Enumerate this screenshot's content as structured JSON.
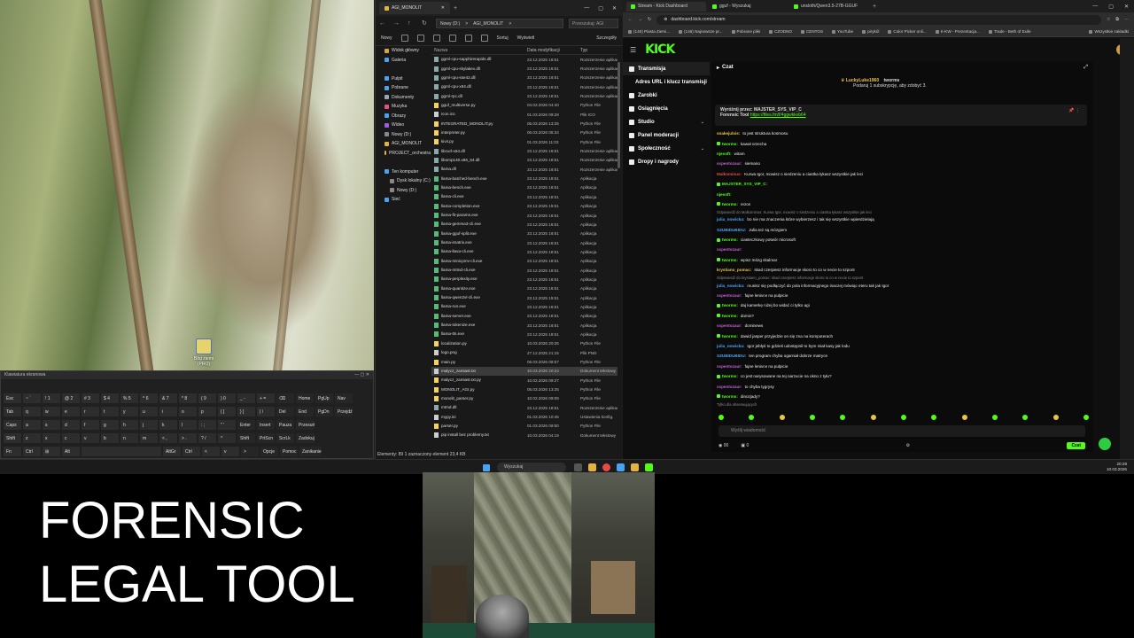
{
  "desktop": {
    "icon_label": "Bóg ziemi (PRO)"
  },
  "keyboard": {
    "title": "Klawiatura ekranowa",
    "rows": [
      [
        "Esc",
        "~ `",
        "! 1",
        "@ 2",
        "# 3",
        "$ 4",
        "% 5",
        "^ 6",
        "& 7",
        "* 8",
        "( 9",
        ") 0",
        "_ -",
        "+ =",
        "⌫",
        "Home",
        "PgUp",
        "Nav"
      ],
      [
        "Tab",
        "q",
        "w",
        "e",
        "r",
        "t",
        "y",
        "u",
        "i",
        "o",
        "p",
        "{ [",
        "} ]",
        "| \\",
        "Del",
        "End",
        "PgDn",
        "Przejdź"
      ],
      [
        "Caps",
        "a",
        "s",
        "d",
        "f",
        "g",
        "h",
        "j",
        "k",
        "l",
        ": ;",
        "\" '",
        "Enter",
        "Insert",
        "Pauza",
        "Przesuń"
      ],
      [
        "Shift",
        "z",
        "x",
        "c",
        "v",
        "b",
        "n",
        "m",
        "< ,",
        "> .",
        "? /",
        "^",
        "Shift",
        "PrtScn",
        "ScrLk",
        "Zadokuj"
      ],
      [
        "Fn",
        "Ctrl",
        "⊞",
        "Alt",
        "",
        "AltGr",
        "Ctrl",
        "<",
        "v",
        ">",
        "Opcje",
        "Pomoc",
        "Zanikanie"
      ]
    ]
  },
  "explorer": {
    "tab_title": "AGI_MONOLIT",
    "address": [
      "Nowy (D:)",
      ">",
      "AGI_MONOLIT",
      ">"
    ],
    "search_placeholder": "Przeszukaj: AGI",
    "toolbar": {
      "new": "Nowy",
      "sort": "Sortuj",
      "view": "Wyświetl",
      "details": "Szczegóły"
    },
    "nav_items": [
      {
        "label": "Widok główny",
        "color": "#d9a441"
      },
      {
        "label": "Galeria",
        "color": "#4aa3f0"
      },
      {
        "label": "",
        "color": "#000000"
      },
      {
        "label": "Pulpit",
        "color": "#4aa3f0"
      },
      {
        "label": "Pobrane",
        "color": "#4aa3f0"
      },
      {
        "label": "Dokumenty",
        "color": "#9aa7b8"
      },
      {
        "label": "Muzyka",
        "color": "#e8507a"
      },
      {
        "label": "Obrazy",
        "color": "#4aa3f0"
      },
      {
        "label": "Wideo",
        "color": "#9c5ee0"
      },
      {
        "label": "Nowy (D:)",
        "color": "#888888"
      },
      {
        "label": "AGI_MONOLIT",
        "color": "#e3b341"
      },
      {
        "label": "PROJECT_orchestra",
        "color": "#e3b341"
      },
      {
        "label": "",
        "color": "#000000"
      },
      {
        "label": "Ten komputer",
        "color": "#4aa3f0"
      },
      {
        "label": "Dysk lokalny (C:)",
        "color": "#888888"
      },
      {
        "label": "Nowy (D:)",
        "color": "#888888"
      },
      {
        "label": "Sieć",
        "color": "#4aa3f0"
      }
    ],
    "columns": [
      "Nazwa",
      "Data modyfikacji",
      "Typ"
    ],
    "files": [
      {
        "name": "ggml-cpu-sapphirerapids.dll",
        "date": "23.12.2025 18:51",
        "type": "Rozszerzenie aplikacji",
        "kind": "dll"
      },
      {
        "name": "ggml-cpu-skylakex.dll",
        "date": "23.12.2025 18:51",
        "type": "Rozszerzenie aplikacji",
        "kind": "dll"
      },
      {
        "name": "ggml-cpu-sse42.dll",
        "date": "23.12.2025 18:51",
        "type": "Rozszerzenie aplikacji",
        "kind": "dll"
      },
      {
        "name": "ggml-cpu-x64.dll",
        "date": "23.12.2025 18:51",
        "type": "Rozszerzenie aplikacji",
        "kind": "dll"
      },
      {
        "name": "ggml-rpc.dll",
        "date": "23.12.2025 18:51",
        "type": "Rozszerzenie aplikacji",
        "kind": "dll"
      },
      {
        "name": "gguf_multiverse.py",
        "date": "04.02.2026 04:40",
        "type": "Python File",
        "kind": "py"
      },
      {
        "name": "icon.ico",
        "date": "01.03.2026 09:28",
        "type": "Plik ICO",
        "kind": "txt"
      },
      {
        "name": "INTEGRATED_MONOLIT.py",
        "date": "05.03.2026 13:25",
        "type": "Python File",
        "kind": "py"
      },
      {
        "name": "interpreter.py",
        "date": "06.03.2026 05:34",
        "type": "Python File",
        "kind": "py"
      },
      {
        "name": "kivir.py",
        "date": "01.03.2026 11:03",
        "type": "Python File",
        "kind": "py"
      },
      {
        "name": "libcurl-x64.dll",
        "date": "23.12.2025 18:51",
        "type": "Rozszerzenie aplikacji",
        "kind": "dll"
      },
      {
        "name": "libomp140.x86_64.dll",
        "date": "23.12.2025 18:51",
        "type": "Rozszerzenie aplikacji",
        "kind": "dll"
      },
      {
        "name": "llama.dll",
        "date": "23.12.2025 18:51",
        "type": "Rozszerzenie aplikacji",
        "kind": "dll"
      },
      {
        "name": "llama-batched-bench.exe",
        "date": "23.12.2025 18:51",
        "type": "Aplikacja",
        "kind": "exe"
      },
      {
        "name": "llama-bench.exe",
        "date": "23.12.2025 18:51",
        "type": "Aplikacja",
        "kind": "exe"
      },
      {
        "name": "llama-cli.exe",
        "date": "23.12.2025 18:51",
        "type": "Aplikacja",
        "kind": "exe"
      },
      {
        "name": "llama-completion.exe",
        "date": "23.12.2025 18:51",
        "type": "Aplikacja",
        "kind": "exe"
      },
      {
        "name": "llama-fit-params.exe",
        "date": "23.12.2025 18:51",
        "type": "Aplikacja",
        "kind": "exe"
      },
      {
        "name": "llama-gemma3-cli.exe",
        "date": "23.12.2025 18:51",
        "type": "Aplikacja",
        "kind": "exe"
      },
      {
        "name": "llama-gguf-split.exe",
        "date": "23.12.2025 18:51",
        "type": "Aplikacja",
        "kind": "exe"
      },
      {
        "name": "llama-imatrix.exe",
        "date": "23.12.2025 18:51",
        "type": "Aplikacja",
        "kind": "exe"
      },
      {
        "name": "llama-llava-cli.exe",
        "date": "23.12.2025 18:51",
        "type": "Aplikacja",
        "kind": "exe"
      },
      {
        "name": "llama-minicpmv-cli.exe",
        "date": "23.12.2025 18:51",
        "type": "Aplikacja",
        "kind": "exe"
      },
      {
        "name": "llama-mtmd-cli.exe",
        "date": "23.12.2025 18:51",
        "type": "Aplikacja",
        "kind": "exe"
      },
      {
        "name": "llama-perplexity.exe",
        "date": "23.12.2025 18:51",
        "type": "Aplikacja",
        "kind": "exe"
      },
      {
        "name": "llama-quantize.exe",
        "date": "23.12.2025 18:51",
        "type": "Aplikacja",
        "kind": "exe"
      },
      {
        "name": "llama-qwen2vl-cli.exe",
        "date": "23.12.2025 18:51",
        "type": "Aplikacja",
        "kind": "exe"
      },
      {
        "name": "llama-run.exe",
        "date": "23.12.2025 18:51",
        "type": "Aplikacja",
        "kind": "exe"
      },
      {
        "name": "llama-server.exe",
        "date": "23.12.2025 18:51",
        "type": "Aplikacja",
        "kind": "exe"
      },
      {
        "name": "llama-tokenize.exe",
        "date": "23.12.2025 18:51",
        "type": "Aplikacja",
        "kind": "exe"
      },
      {
        "name": "llama-tts.exe",
        "date": "23.12.2025 18:51",
        "type": "Aplikacja",
        "kind": "exe"
      },
      {
        "name": "localization.py",
        "date": "10.03.2026 20:25",
        "type": "Python File",
        "kind": "py"
      },
      {
        "name": "logo.png",
        "date": "27.12.2025 21:15",
        "type": "Plik PNG",
        "kind": "txt"
      },
      {
        "name": "main.py",
        "date": "06.03.2026 08:57",
        "type": "Python File",
        "kind": "py"
      },
      {
        "name": "malycz_zamiast.txt",
        "date": "10.03.2026 20:24",
        "type": "Dokument tekstowy",
        "kind": "txt",
        "selected": true
      },
      {
        "name": "malycz_zamiast.txt.py",
        "date": "10.02.2026 09:27",
        "type": "Python File",
        "kind": "py"
      },
      {
        "name": "MONOLIT_AGI.py",
        "date": "05.03.2026 13:25",
        "type": "Python File",
        "kind": "py"
      },
      {
        "name": "monolit_parser.py",
        "date": "10.02.2026 09:09",
        "type": "Python File",
        "kind": "py"
      },
      {
        "name": "mtmd.dll",
        "date": "23.12.2025 18:51",
        "type": "Rozszerzenie aplikacji",
        "kind": "dll"
      },
      {
        "name": "mypy.ini",
        "date": "01.03.2026 10:45",
        "type": "Ustawienia konfig.",
        "kind": "txt"
      },
      {
        "name": "parser.py",
        "date": "01.03.2026 09:50",
        "type": "Python File",
        "kind": "py"
      },
      {
        "name": "pip install bez problemy.txt",
        "date": "10.03.2026 04:19",
        "type": "Dokument tekstowy",
        "kind": "txt"
      }
    ],
    "status": "Elementy: 89   1 zaznaczony element  23,4 KB"
  },
  "browser": {
    "tabs": [
      {
        "label": "Stream - Kick Dashboard",
        "active": true
      },
      {
        "label": "gguf - Wyszukaj",
        "active": false
      },
      {
        "label": "unsloth/Qwen3.5-27B-GGUF",
        "active": false
      }
    ],
    "url": "dashboard.kick.com/stream",
    "bookmarks": [
      "(146) Piasta Ziemi...",
      "(146) Najnowsze pr...",
      "Pobrane pliki",
      "CZODNO",
      "CENTOS",
      "YouTube",
      "pirykól",
      "Color Picker onli...",
      "K-KW - Prezentacja...",
      "Trade - Beth of Exile",
      "Wszystkie zakładki"
    ],
    "kick": {
      "logo": "KICK",
      "sidebar": [
        {
          "label": "Transmisja",
          "selected": true,
          "chevron": false
        },
        {
          "label": "Adres URL i klucz transmisji",
          "selected": false,
          "chevron": false
        },
        {
          "label": "Zarobki",
          "selected": false,
          "chevron": false
        },
        {
          "label": "Osiągnięcia",
          "selected": false,
          "chevron": false
        },
        {
          "label": "Studio",
          "selected": false,
          "chevron": true
        },
        {
          "label": "Panel moderacji",
          "selected": false,
          "chevron": false
        },
        {
          "label": "Społeczność",
          "selected": false,
          "chevron": true
        },
        {
          "label": "Dropy i nagrody",
          "selected": false,
          "chevron": false
        }
      ],
      "chat_title": "Czat",
      "pinned_user": "LuckyLuke1960",
      "pinned_user_target": "tworms",
      "pinned_user_sub": "Podaruj 1 subskrypcję, aby zdobyć 3.",
      "pinned_by": "Wyróżnij przez: MAJSTER_SYS_VIP_C",
      "pinned_text": "Forensic Tool",
      "pinned_link": "https://files.fm/f/4ggwkkvb64",
      "messages": [
        {
          "user": "snakejulsis:",
          "text": "to jest struktura kosmosu",
          "color": "#e8c547",
          "badge": false,
          "reply": false
        },
        {
          "user": "tworms:",
          "text": "kawał orzecha",
          "color": "#53fc18",
          "badge": true,
          "reply": false
        },
        {
          "user": "njesoft:",
          "text": "witam",
          "color": "#53fc18",
          "badge": false,
          "reply": false
        },
        {
          "user": "sspentozaur:",
          "text": "siemano",
          "color": "#c65bd8",
          "badge": false,
          "reply": false
        },
        {
          "user": "Malkominus:",
          "text": "Kurwa Igor, mowisz o siedzeniu a ciastka łykasz wszystkie jak leci",
          "color": "#e84a4a",
          "badge": false,
          "reply": false
        },
        {
          "user": "MAJSTER_SYS_VIP_C:",
          "text": "",
          "color": "#53fc18",
          "badge": true,
          "reply": false
        },
        {
          "user": "njesoft:",
          "text": "",
          "color": "#53fc18",
          "badge": false,
          "reply": false
        },
        {
          "user": "tworms:",
          "text": "rezon",
          "color": "#53fc18",
          "badge": true,
          "reply": false
        },
        {
          "user": "",
          "text": "Odpowiedź do Malkominus: Kurwa Igor, mowisz o siedzeniu a ciastka łykasz wszystkie jak leci",
          "color": "#888888",
          "badge": false,
          "reply": true
        },
        {
          "user": "julia_nowicka:",
          "text": "bo nie ma znaczenia które wybierzesz i tak się wszystkie wpierdzielają",
          "color": "#4aa3f0",
          "badge": false,
          "reply": false
        },
        {
          "user": "SZUBIDUBIDU:",
          "text": "Julia też są mózgiem",
          "color": "#4aa3f0",
          "badge": false,
          "reply": false
        },
        {
          "user": "tworms:",
          "text": "ciasteczkowy potwór microsoft",
          "color": "#53fc18",
          "badge": true,
          "reply": false
        },
        {
          "user": "sspentozaur:",
          "text": "",
          "color": "#c65bd8",
          "badge": false,
          "reply": false
        },
        {
          "user": "tworms:",
          "text": "wpisz mózg skalmar",
          "color": "#53fc18",
          "badge": true,
          "reply": false
        },
        {
          "user": "krystiano_pomac:",
          "text": "skad czerpiesz informacje skoro to co w necie to szpont",
          "color": "#e8c547",
          "badge": false,
          "reply": false
        },
        {
          "user": "",
          "text": "Odpowiedź do krystiano_pomac: skad czerpiesz informacje skoro to co w necie to szpont",
          "color": "#888888",
          "badge": false,
          "reply": true
        },
        {
          "user": "julia_nowicka:",
          "text": "musisz się podłączyć do pola informacyjnego inaczej mówiąc eteru tak jak Igor",
          "color": "#4aa3f0",
          "badge": false,
          "reply": false
        },
        {
          "user": "sspentozaur:",
          "text": "fajne lenivce na pulpicie",
          "color": "#c65bd8",
          "badge": false,
          "reply": false
        },
        {
          "user": "tworms:",
          "text": "daj kamerkę niżej bo widać ci tylko agi",
          "color": "#53fc18",
          "badge": true,
          "reply": false
        },
        {
          "user": "tworms:",
          "text": "domin?",
          "color": "#53fc18",
          "badge": true,
          "reply": false
        },
        {
          "user": "sspentozaur:",
          "text": "dominews",
          "color": "#c65bd8",
          "badge": false,
          "reply": false
        },
        {
          "user": "tworms:",
          "text": "dawid jasper przyjedzie on się zna na komputerach",
          "color": "#53fc18",
          "badge": true,
          "reply": false
        },
        {
          "user": "julia_nowicka:",
          "text": "Igor jebłyś to gdzieś udostępnił to bym miał kasy jak lodu",
          "color": "#4aa3f0",
          "badge": false,
          "reply": false
        },
        {
          "user": "SZUBIDUBIDU:",
          "text": "ten program chyba ogarniał dobrze matryce",
          "color": "#4aa3f0",
          "badge": false,
          "reply": false
        },
        {
          "user": "sspentozaur:",
          "text": "fajne lenivce na pulpicie",
          "color": "#c65bd8",
          "badge": false,
          "reply": false
        },
        {
          "user": "tworms:",
          "text": "co jest narysowane na tej narzucie na okno z tyłu?",
          "color": "#53fc18",
          "badge": true,
          "reply": false
        },
        {
          "user": "sspentozaur:",
          "text": "to chyba tygrysy",
          "color": "#c65bd8",
          "badge": false,
          "reply": false
        },
        {
          "user": "tworms:",
          "text": "dinozjady?",
          "color": "#53fc18",
          "badge": true,
          "reply": false
        },
        {
          "user": "",
          "text": "Tylko dla obserwujących",
          "color": "#888888",
          "badge": false,
          "reply": true
        }
      ],
      "input_placeholder": "Wyślij wiadomość",
      "viewers": "00",
      "count": "0",
      "send_label": "Czat"
    }
  },
  "taskbar": {
    "search": "Wyszukaj",
    "time": "20:28",
    "date": "10.03.2026"
  },
  "overlay": {
    "line1": "FORENSIC",
    "line2": "LEGAL TOOL"
  }
}
